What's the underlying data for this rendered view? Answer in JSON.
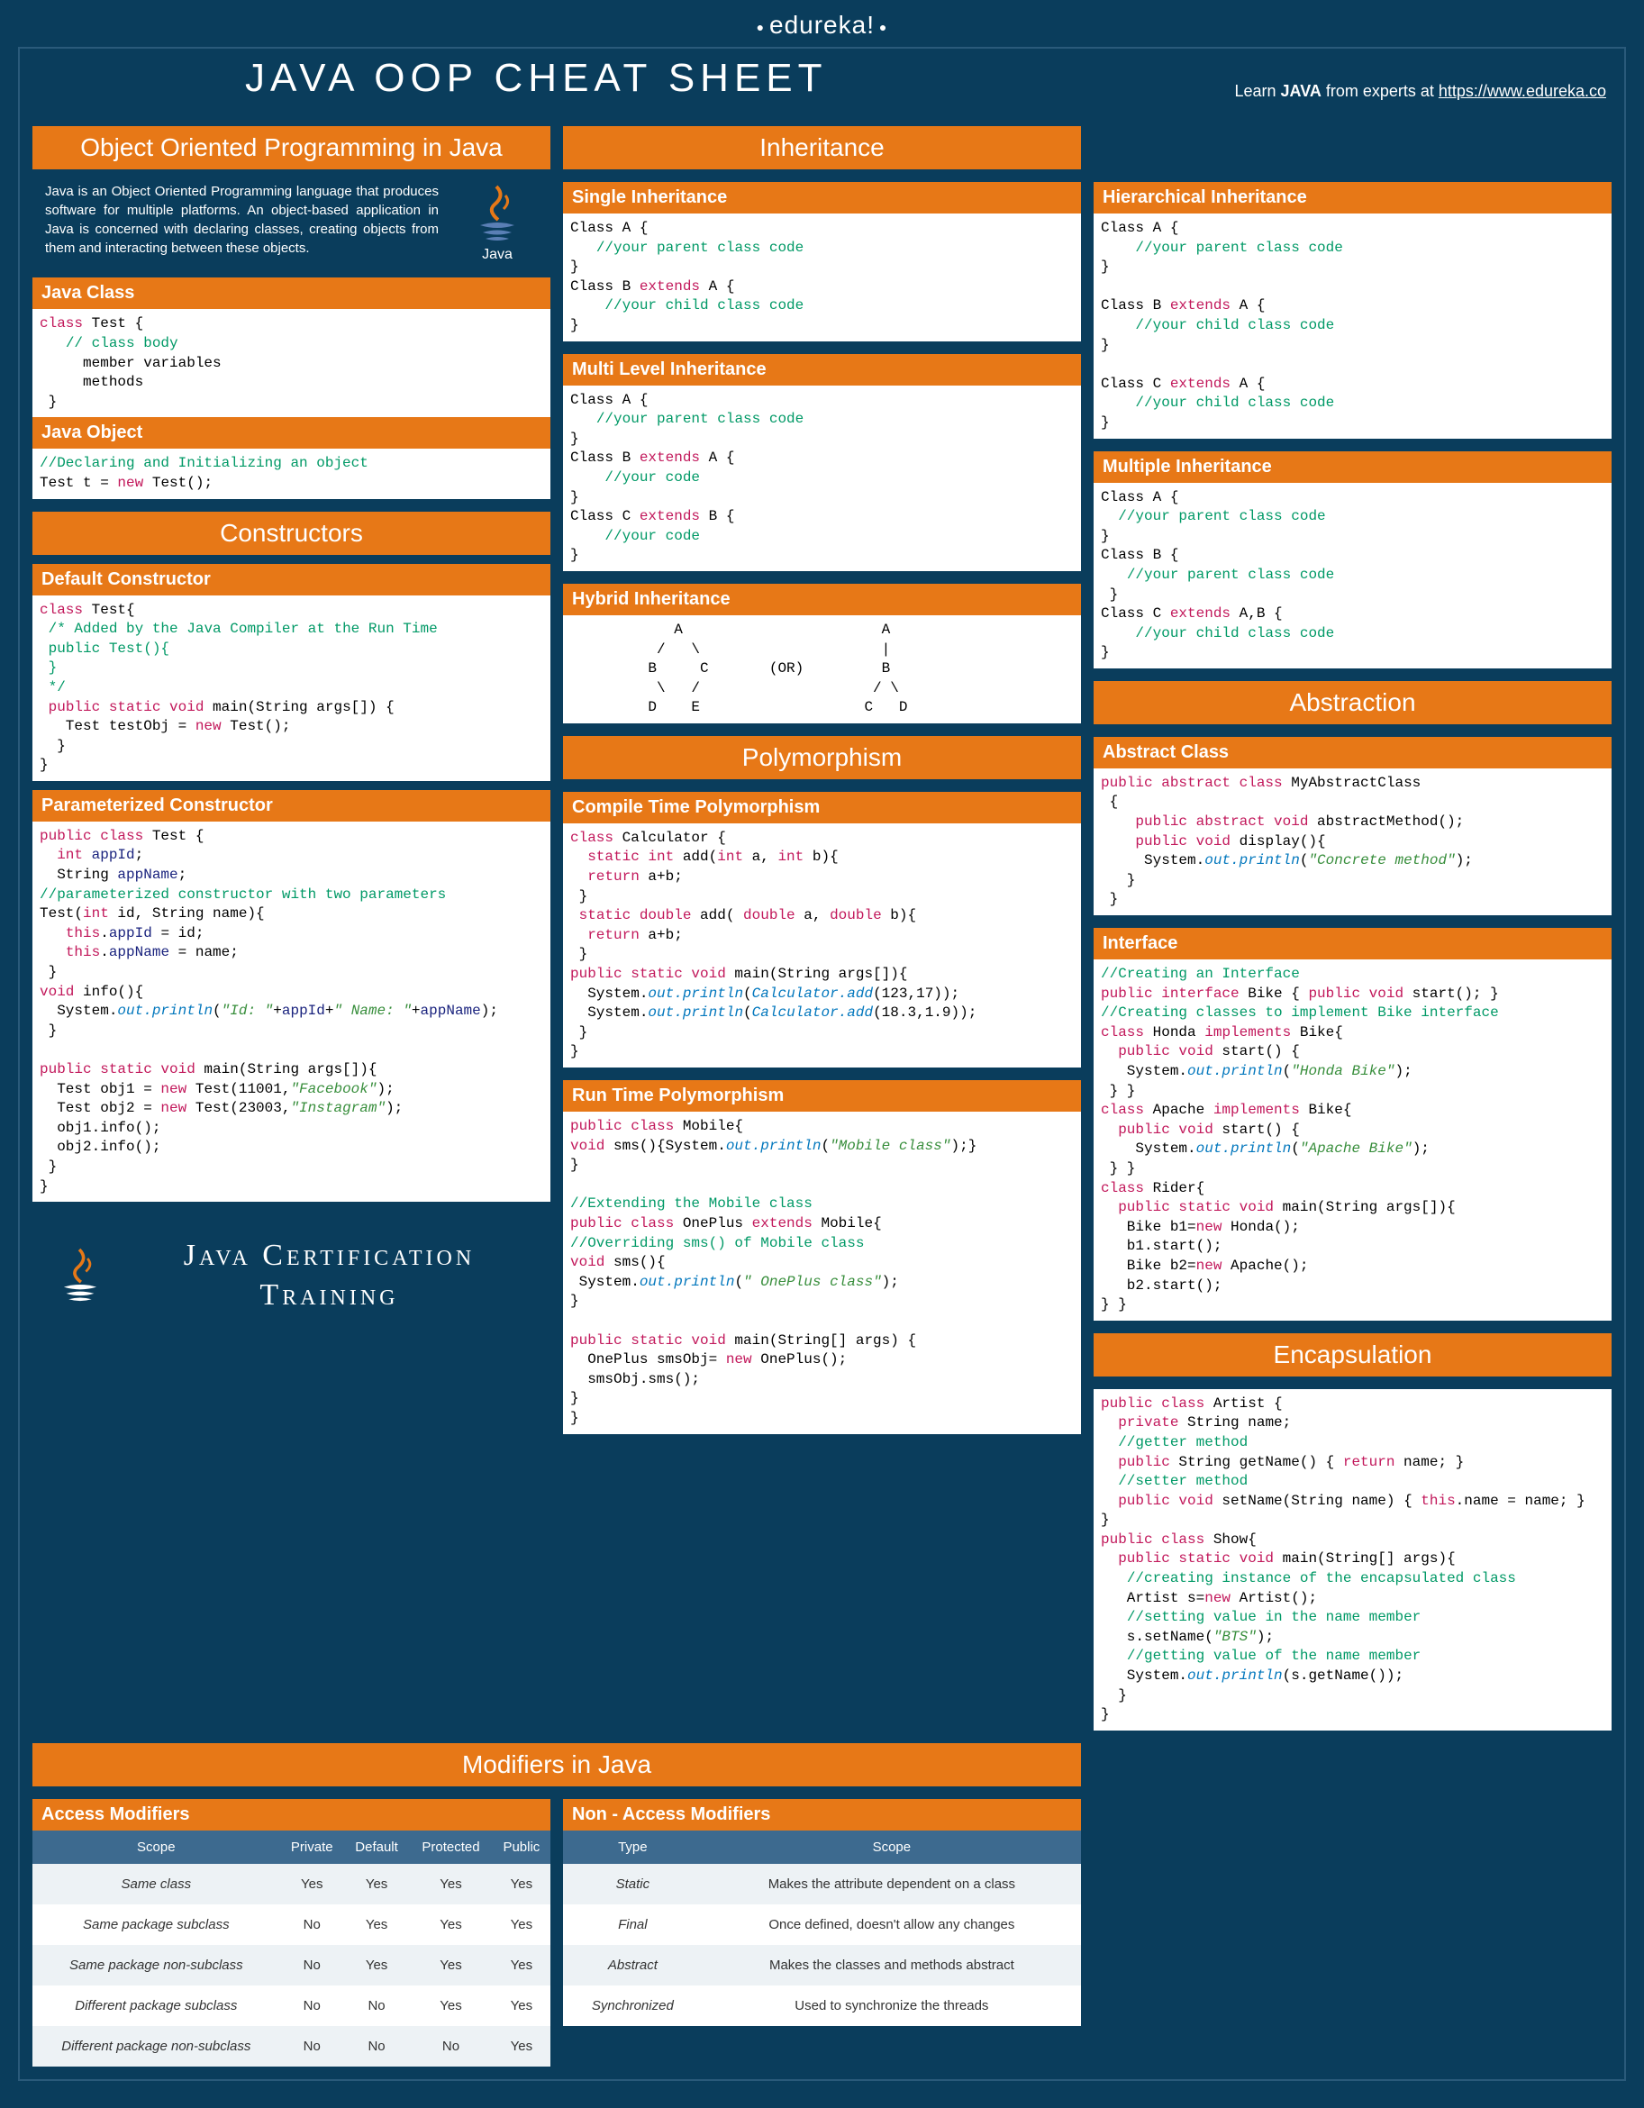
{
  "brand": "edureka!",
  "title": "JAVA OOP CHEAT SHEET",
  "learn_prefix": "Learn ",
  "learn_bold": "JAVA",
  "learn_suffix": " from experts at ",
  "learn_url": "https://www.edureka.co",
  "col1": {
    "h_oop": "Object Oriented Programming in Java",
    "intro": "Java is an Object Oriented Programming language that produces software for multiple platforms. An object-based application in Java is concerned with declaring classes, creating objects from them and interacting between these objects.",
    "java_label": "Java",
    "h_class": "Java Class",
    "code_class": "<span class='kw'>class</span> Test {\n   <span class='cm'>// class body</span>\n     member variables\n     methods\n }",
    "h_obj": "Java Object",
    "code_obj": "<span class='cm'>//Declaring and Initializing an object</span>\nTest t = <span class='kw'>new</span> Test();",
    "h_ctor": "Constructors",
    "h_def": "Default Constructor",
    "code_def": "<span class='kw'>class</span> Test{\n <span class='cm'>/* Added by the Java Compiler at the Run Time</span>\n <span class='cm'>public Test(){</span>\n <span class='cm'>}</span>\n <span class='cm'>*/</span>\n <span class='kw'>public static void</span> main(String args[]) {\n   Test testObj = <span class='kw'>new</span> Test();\n  }\n}",
    "h_param": "Parameterized Constructor",
    "code_param": "<span class='kw'>public class</span> Test {\n  <span class='kw'>int</span> <span class='ty'>appId</span>;\n  String <span class='ty'>appName</span>;\n<span class='cm'>//parameterized constructor with two parameters</span>\nTest(<span class='kw'>int</span> id, String name){\n   <span class='kw'>this</span>.<span class='ty'>appId</span> = id;\n   <span class='kw'>this</span>.<span class='ty'>appName</span> = name;\n }\n<span class='kw'>void</span> info(){\n  System.<span class='fn'>out.println</span>(<span class='st'>\"Id: \"</span>+<span class='ty'>appId</span>+<span class='st'>\" Name: \"</span>+<span class='ty'>appName</span>);\n }\n\n<span class='kw'>public static void</span> main(String args[]){\n  Test obj1 = <span class='kw'>new</span> Test(11001,<span class='st'>\"Facebook\"</span>);\n  Test obj2 = <span class='kw'>new</span> Test(23003,<span class='st'>\"Instagram\"</span>);\n  obj1.info();\n  obj2.info();\n }\n}",
    "cert": "Java Certification Training"
  },
  "col2": {
    "h_inh": "Inheritance",
    "h_single": "Single Inheritance",
    "code_single": "Class A {\n   <span class='cm'>//your parent class code</span>\n}\nClass B <span class='kw'>extends</span> A {\n    <span class='cm'>//your child class code</span>\n}",
    "h_multi": "Multi Level Inheritance",
    "code_multi": "Class A {\n   <span class='cm'>//your parent class code</span>\n}\nClass B <span class='kw'>extends</span> A {\n    <span class='cm'>//your code</span>\n}\nClass C <span class='kw'>extends</span> B {\n    <span class='cm'>//your code</span>\n}",
    "h_hybrid": "Hybrid Inheritance",
    "code_hybrid": "            A                       A\n          /   \\                     |\n         B     C       (OR)         B\n          \\   /                    / \\\n         D    E                   C   D",
    "h_poly": "Polymorphism",
    "h_ct": "Compile Time Polymorphism",
    "code_ct": "<span class='kw'>class</span> Calculator {\n  <span class='kw'>static int</span> add(<span class='kw'>int</span> a, <span class='kw'>int</span> b){\n  <span class='kw'>return</span> a+b;\n }\n <span class='kw'>static double</span> add( <span class='kw'>double</span> a, <span class='kw'>double</span> b){\n  <span class='kw'>return</span> a+b;\n }\n<span class='kw'>public static void</span> main(String args[]){\n  System.<span class='fn'>out.println</span>(<span class='fn'>Calculator.add</span>(123,17));\n  System.<span class='fn'>out.println</span>(<span class='fn'>Calculator.add</span>(18.3,1.9));\n }\n}",
    "h_rt": "Run Time Polymorphism",
    "code_rt": "<span class='kw'>public class</span> Mobile{\n<span class='kw'>void</span> sms(){System.<span class='fn'>out.println</span>(<span class='st'>\"Mobile class\"</span>);}\n}\n\n<span class='cm'>//Extending the Mobile class</span>\n<span class='kw'>public class</span> OnePlus <span class='kw'>extends</span> Mobile{\n<span class='cm'>//Overriding sms() of Mobile class</span>\n<span class='kw'>void</span> sms(){\n System.<span class='fn'>out.println</span>(<span class='st'>\" OnePlus class\"</span>);\n}\n\n<span class='kw'>public static void</span> main(String[] args) {\n  OnePlus smsObj= <span class='kw'>new</span> OnePlus();\n  smsObj.sms();\n}\n}"
  },
  "col3": {
    "h_hier": "Hierarchical Inheritance",
    "code_hier": "Class A {\n    <span class='cm'>//your parent class code</span>\n}\n\nClass B <span class='kw'>extends</span> A {\n    <span class='cm'>//your child class code</span>\n}\n\nClass C <span class='kw'>extends</span> A {\n    <span class='cm'>//your child class code</span>\n}",
    "h_mult": "Multiple  Inheritance",
    "code_mult": "Class A {\n  <span class='cm'>//your parent class code</span>\n}\nClass B {\n   <span class='cm'>//your parent class code</span>\n }\nClass C <span class='kw'>extends</span> A,B {\n    <span class='cm'>//your child class code</span>\n}",
    "h_abs": "Abstraction",
    "h_absc": "Abstract Class",
    "code_absc": "<span class='kw'>public abstract class</span> MyAbstractClass\n {\n    <span class='kw'>public abstract void</span> abstractMethod();\n    <span class='kw'>public void</span> display(){\n     System.<span class='fn'>out.println</span>(<span class='st'>\"Concrete method\"</span>);\n   }\n }",
    "h_if": "Interface",
    "code_if": "<span class='cm'>//Creating an Interface</span>\n<span class='kw'>public interface</span> Bike { <span class='kw'>public void</span> start(); }\n<span class='cm'>//Creating classes to implement Bike interface</span>\n<span class='kw'>class</span> Honda <span class='kw'>implements</span> Bike{\n  <span class='kw'>public void</span> start() {\n   System.<span class='fn'>out.println</span>(<span class='st'>\"Honda Bike\"</span>);\n } }\n<span class='kw'>class</span> Apache <span class='kw'>implements</span> Bike{\n  <span class='kw'>public void</span> start() {\n    System.<span class='fn'>out.println</span>(<span class='st'>\"Apache Bike\"</span>);\n } }\n<span class='kw'>class</span> Rider{\n  <span class='kw'>public static void</span> main(String args[]){\n   Bike b1=<span class='kw'>new</span> Honda();\n   b1.start();\n   Bike b2=<span class='kw'>new</span> Apache();\n   b2.start();\n} }",
    "h_enc": "Encapsulation",
    "code_enc": "<span class='kw'>public class</span> Artist {\n  <span class='kw'>private</span> String name;\n  <span class='cm'>//getter method</span>\n  <span class='kw'>public</span> String getName() { <span class='kw'>return</span> name; }\n  <span class='cm'>//setter method</span>\n  <span class='kw'>public void</span> setName(String name) { <span class='kw'>this</span>.name = name; }\n}\n<span class='kw'>public class</span> Show{\n  <span class='kw'>public static void</span> main(String[] args){\n   <span class='cm'>//creating instance of the encapsulated class</span>\n   Artist s=<span class='kw'>new</span> Artist();\n   <span class='cm'>//setting value in the name member</span>\n   s.setName(<span class='st'>\"BTS\"</span>);\n   <span class='cm'>//getting value of the name member</span>\n   System.<span class='fn'>out.println</span>(s.getName());\n  }\n}"
  },
  "mod": {
    "h": "Modifiers in Java",
    "h_acc": "Access Modifiers",
    "acc_head": [
      "Scope",
      "Private",
      "Default",
      "Protected",
      "Public"
    ],
    "acc_rows": [
      [
        "Same class",
        "Yes",
        "Yes",
        "Yes",
        "Yes"
      ],
      [
        "Same package subclass",
        "No",
        "Yes",
        "Yes",
        "Yes"
      ],
      [
        "Same package non-subclass",
        "No",
        "Yes",
        "Yes",
        "Yes"
      ],
      [
        "Different package subclass",
        "No",
        "No",
        "Yes",
        "Yes"
      ],
      [
        "Different package non-subclass",
        "No",
        "No",
        "No",
        "Yes"
      ]
    ],
    "h_non": "Non - Access Modifiers",
    "non_head": [
      "Type",
      "Scope"
    ],
    "non_rows": [
      [
        "Static",
        "Makes the attribute dependent on a class"
      ],
      [
        "Final",
        "Once defined, doesn't allow any changes"
      ],
      [
        "Abstract",
        "Makes the classes and methods abstract"
      ],
      [
        "Synchronized",
        "Used to synchronize the threads"
      ]
    ]
  }
}
